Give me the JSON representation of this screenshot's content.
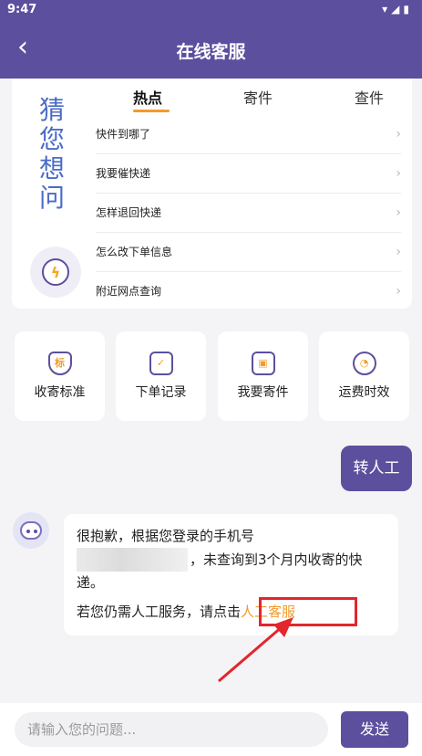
{
  "status_bar": {
    "time": "9:47",
    "icons": [
      "wifi-icon",
      "signal-icon",
      "battery-icon"
    ]
  },
  "header": {
    "title": "在线客服",
    "back_icon": "chevron-left-icon"
  },
  "guess": {
    "label_chars": [
      "猜",
      "您",
      "想",
      "问"
    ],
    "tabs": [
      {
        "label": "热点",
        "active": true
      },
      {
        "label": "寄件",
        "active": false
      },
      {
        "label": "查件",
        "active": false
      }
    ],
    "items": [
      "快件到哪了",
      "我要催快递",
      "怎样退回快递",
      "怎么改下单信息",
      "附近网点查询"
    ]
  },
  "quick_actions": [
    {
      "label": "收寄标准",
      "icon": "shield-icon",
      "glyph": "标"
    },
    {
      "label": "下单记录",
      "icon": "clipboard-check-icon",
      "glyph": "✓"
    },
    {
      "label": "我要寄件",
      "icon": "package-icon",
      "glyph": "▣"
    },
    {
      "label": "运费时效",
      "icon": "gauge-icon",
      "glyph": "◔"
    }
  ],
  "chat": {
    "user_message": "转人工",
    "bot_message": {
      "line1": "很抱歉，根据您登录的手机号",
      "line2_suffix": "，未查询到3个月内收寄的快",
      "line3": "递。",
      "line4_prefix": "若您仍需人工服务，请点击",
      "link_text": "人工客服"
    }
  },
  "input": {
    "placeholder": "请输入您的问题..."
  },
  "send_label": "发送",
  "colors": {
    "brand": "#5c4f9e",
    "accent": "#f19b2c",
    "annotation": "#e3262c"
  }
}
